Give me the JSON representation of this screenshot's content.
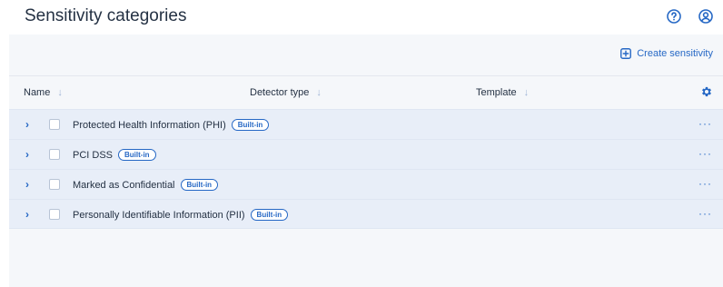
{
  "header": {
    "title": "Sensitivity categories",
    "help_icon": "question-circle-icon",
    "account_icon": "user-circle-icon"
  },
  "toolbar": {
    "create_label": "Create sensitivity",
    "create_icon": "plus-square-icon"
  },
  "table": {
    "columns": [
      {
        "label": "Name",
        "sort_icon": "sort-down-icon"
      },
      {
        "label": "Detector type",
        "sort_icon": "sort-down-icon"
      },
      {
        "label": "Template",
        "sort_icon": "sort-down-icon"
      }
    ],
    "settings_icon": "gear-icon",
    "rows": [
      {
        "name": "Protected Health Information (PHI)",
        "badge": "Built-in"
      },
      {
        "name": "PCI DSS",
        "badge": "Built-in"
      },
      {
        "name": "Marked as Confidential",
        "badge": "Built-in"
      },
      {
        "name": "Personally Identifiable Information (PII)",
        "badge": "Built-in"
      }
    ],
    "row_expand_glyph": "›",
    "row_more_glyph": "···"
  },
  "colors": {
    "accent": "#2668c5",
    "text": "#243143",
    "row_bg": "#e8eef8",
    "panel_bg": "#f5f7fa"
  }
}
